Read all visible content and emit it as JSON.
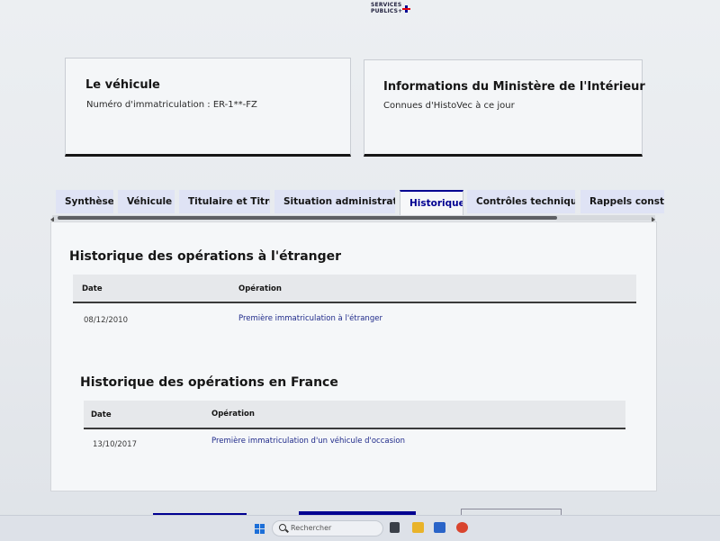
{
  "header": {
    "logo_line1": "SERVICES",
    "logo_line2": "PUBLICS+"
  },
  "vehicle_card": {
    "title": "Le véhicule",
    "plate_text": "Numéro d'immatriculation : ER-1**-FZ"
  },
  "ministry_card": {
    "title": "Informations du Ministère de l'Intérieur",
    "subtitle": "Connues d'HistoVec à ce jour"
  },
  "tabs": [
    {
      "label": "Synthèse",
      "active": false
    },
    {
      "label": "Véhicule",
      "active": false
    },
    {
      "label": "Titulaire et Titre",
      "active": false
    },
    {
      "label": "Situation administrative",
      "active": false
    },
    {
      "label": "Historique",
      "active": true
    },
    {
      "label": "Contrôles techniques",
      "active": false
    },
    {
      "label": "Rappels constructeur",
      "active": false
    }
  ],
  "abroad": {
    "title": "Historique des opérations à l'étranger",
    "col_date": "Date",
    "col_operation": "Opération",
    "rows": [
      {
        "date": "08/12/2010",
        "operation": "Première immatriculation à l'étranger"
      }
    ]
  },
  "france": {
    "title": "Historique des opérations en France",
    "col_date": "Date",
    "col_operation": "Opération",
    "rows": [
      {
        "date": "13/10/2017",
        "operation": "Première immatriculation d'un véhicule d'occasion"
      }
    ]
  },
  "taskbar": {
    "search_placeholder": "Rechercher"
  },
  "colors": {
    "accent": "#000091",
    "tab_bg": "#dfe3f5",
    "link": "#1f2a8a"
  }
}
